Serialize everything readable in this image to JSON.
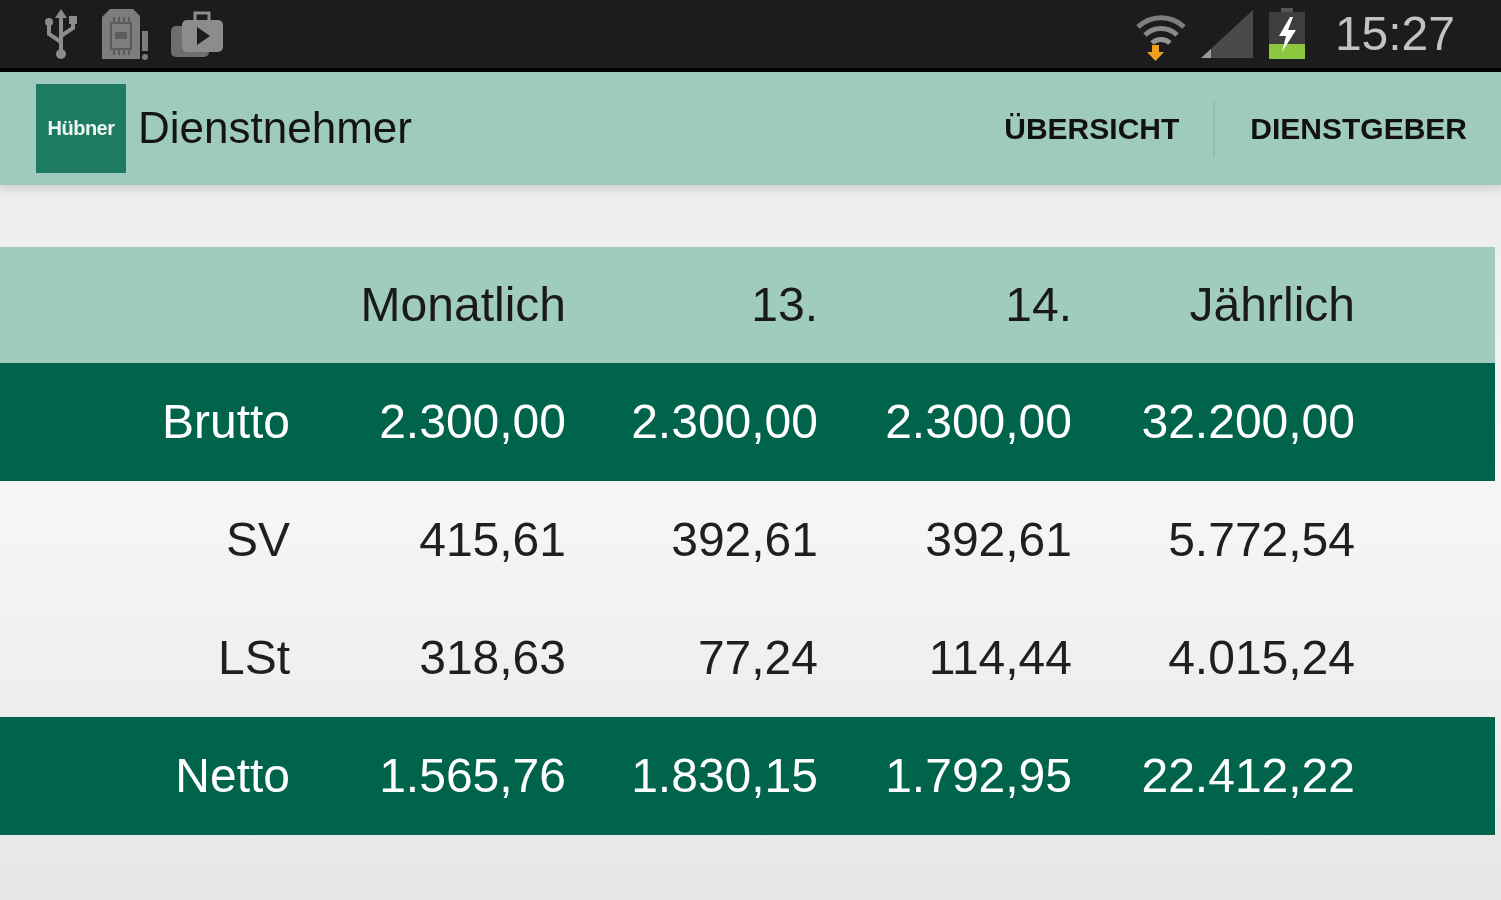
{
  "status_bar": {
    "time": "15:27"
  },
  "app_bar": {
    "logo_text": "Hübner",
    "title": "Dienstnehmer",
    "actions": [
      "ÜBERSICHT",
      "DIENSTGEBER"
    ]
  },
  "table": {
    "columns": [
      "Monatlich",
      "13.",
      "14.",
      "Jährlich"
    ],
    "rows": [
      {
        "kind": "summary",
        "label": "Brutto",
        "values": [
          "2.300,00",
          "2.300,00",
          "2.300,00",
          "32.200,00"
        ]
      },
      {
        "kind": "detail",
        "label": "SV",
        "values": [
          "415,61",
          "392,61",
          "392,61",
          "5.772,54"
        ]
      },
      {
        "kind": "detail",
        "label": "LSt",
        "values": [
          "318,63",
          "77,24",
          "114,44",
          "4.015,24"
        ]
      },
      {
        "kind": "summary",
        "label": "Netto",
        "values": [
          "1.565,76",
          "1.830,15",
          "1.792,95",
          "22.412,22"
        ]
      }
    ]
  }
}
